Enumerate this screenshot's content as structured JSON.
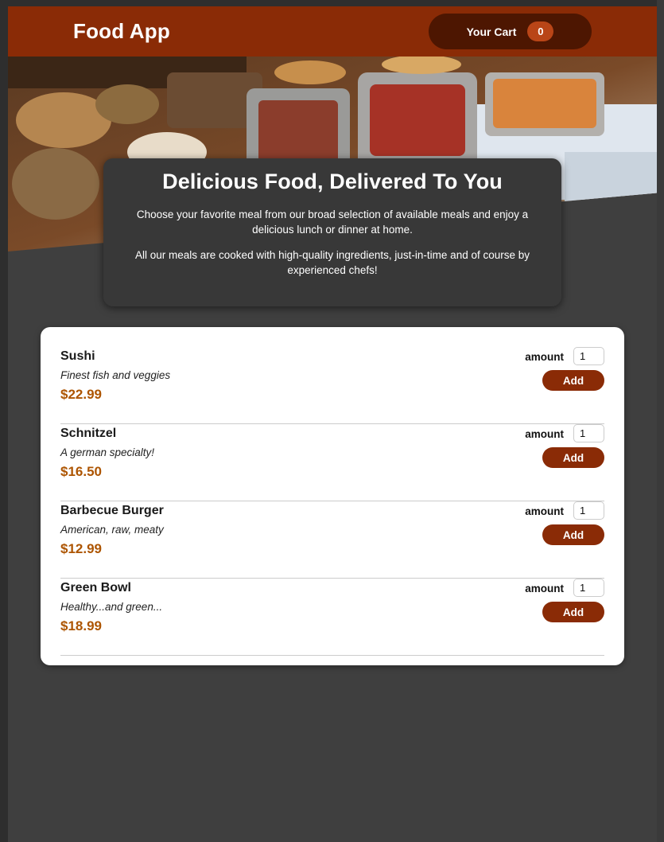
{
  "header": {
    "title": "Food App",
    "cart_label": "Your Cart",
    "cart_count": "0"
  },
  "hero": {
    "image": "buffet-table-photo"
  },
  "summary": {
    "heading": "Delicious Food, Delivered To You",
    "paragraph_1": "Choose your favorite meal from our broad selection of available meals and enjoy a delicious lunch or dinner at home.",
    "paragraph_2": "All our meals are cooked with high-quality ingredients, just-in-time and of course by experienced chefs!"
  },
  "meals": [
    {
      "name": "Sushi",
      "description": "Finest fish and veggies",
      "price": "$22.99",
      "amount_label": "amount",
      "amount_value": "1",
      "add_label": "Add"
    },
    {
      "name": "Schnitzel",
      "description": "A german specialty!",
      "price": "$16.50",
      "amount_label": "amount",
      "amount_value": "1",
      "add_label": "Add"
    },
    {
      "name": "Barbecue Burger",
      "description": "American, raw, meaty",
      "price": "$12.99",
      "amount_label": "amount",
      "amount_value": "1",
      "add_label": "Add"
    },
    {
      "name": "Green Bowl",
      "description": "Healthy...and green...",
      "price": "$18.99",
      "amount_label": "amount",
      "amount_value": "1",
      "add_label": "Add"
    }
  ],
  "colors": {
    "header_bg": "#8a2b06",
    "cart_button_bg": "#4d1601",
    "cart_badge_bg": "#b94517",
    "page_bg": "#3f3f3f",
    "summary_bg": "#383838",
    "price_color": "#ad5502",
    "add_button_bg": "#8a2b06"
  }
}
